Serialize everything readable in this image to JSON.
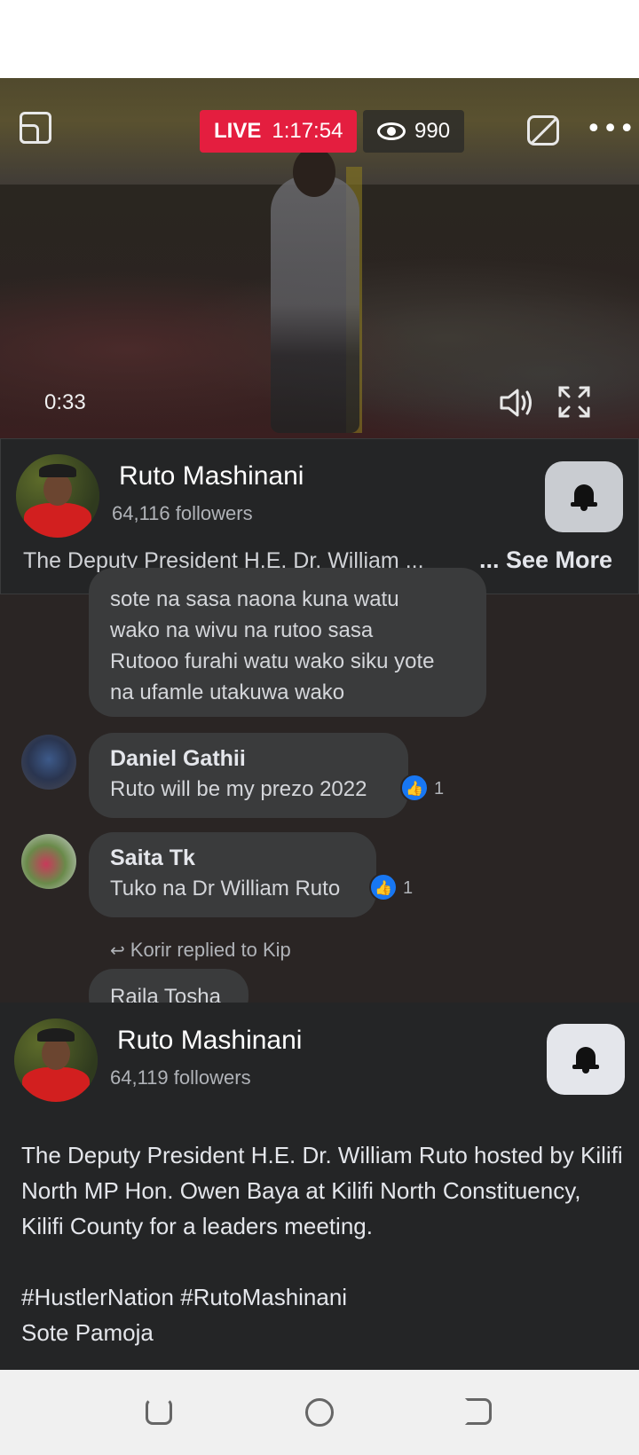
{
  "video": {
    "live_label": "LIVE",
    "live_duration": "1:17:54",
    "viewer_count": "990",
    "elapsed_time": "0:33"
  },
  "page_card": {
    "name": "Ruto Mashinani",
    "followers": "64,116 followers",
    "description_short": "The Deputy President H.E. Dr. William ...",
    "see_more": "... See More"
  },
  "comments": [
    {
      "author": "",
      "lines": [
        "sote na sasa naona kuna watu",
        "wako na wivu na rutoo sasa",
        "Rutooo furahi watu wako siku yote",
        "na ufamle utakuwa wako"
      ]
    },
    {
      "author": "Daniel Gathii",
      "text": "Ruto will be my prezo 2022",
      "likes": "1"
    },
    {
      "author": "Saita Tk",
      "text": "Tuko na Dr William Ruto",
      "likes": "1"
    }
  ],
  "reply_note": "Korir replied to Kip",
  "reply_preview": "Raila Tosha",
  "info_sheet": {
    "name": "Ruto Mashinani",
    "followers": "64,119 followers",
    "post_text": "The Deputy President H.E. Dr. William Ruto hosted by Kilifi North MP Hon. Owen Baya at Kilifi North Constituency, Kilifi County for a leaders meeting.\n\n#HustlerNation #RutoMashinani\nSote Pamoja"
  },
  "colors": {
    "live_red": "#e41e3f",
    "like_blue": "#1877f2",
    "sheet_bg": "#242526"
  },
  "icons": [
    "pip-icon",
    "eye-icon",
    "comment-off-icon",
    "more-icon",
    "volume-icon",
    "fullscreen-icon",
    "bell-icon",
    "like-icon",
    "reply-icon",
    "nav-recent-icon",
    "nav-home-icon",
    "nav-back-icon"
  ]
}
